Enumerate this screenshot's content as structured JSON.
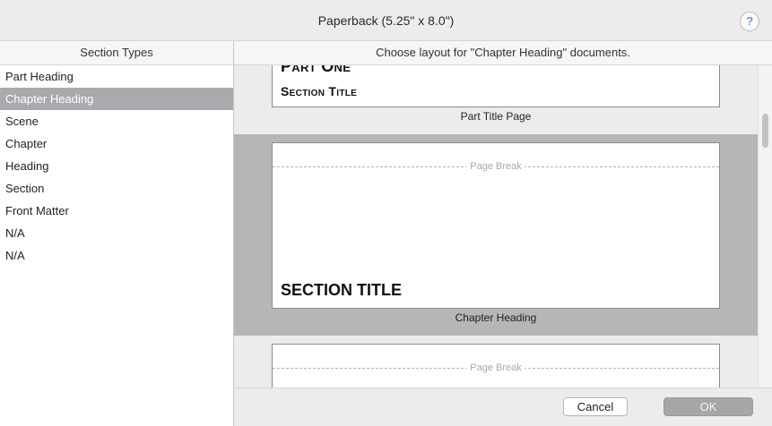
{
  "window": {
    "title": "Paperback (5.25\" x 8.0\")",
    "help_label": "?"
  },
  "sidebar": {
    "header": "Section Types",
    "items": [
      {
        "label": "Part Heading",
        "selected": false
      },
      {
        "label": "Chapter Heading",
        "selected": true
      },
      {
        "label": "Scene",
        "selected": false
      },
      {
        "label": "Chapter",
        "selected": false
      },
      {
        "label": "Heading",
        "selected": false
      },
      {
        "label": "Section",
        "selected": false
      },
      {
        "label": "Front Matter",
        "selected": false
      },
      {
        "label": "N/A",
        "selected": false
      },
      {
        "label": "N/A",
        "selected": false
      }
    ]
  },
  "main": {
    "header": "Choose layout for \"Chapter Heading\" documents.",
    "layouts": [
      {
        "caption": "Part Title Page",
        "lines": [
          "Part One",
          "Section Title"
        ]
      },
      {
        "caption": "Chapter Heading",
        "page_break": "Page Break",
        "section_title": "SECTION TITLE"
      },
      {
        "caption": "",
        "page_break": "Page Break"
      }
    ]
  },
  "footer": {
    "cancel_label": "Cancel",
    "ok_label": "OK"
  },
  "colors": {
    "selection": "#a9a9ae",
    "selected_option_bg": "#b6b6b6",
    "help_icon": "#3b6ad6"
  }
}
